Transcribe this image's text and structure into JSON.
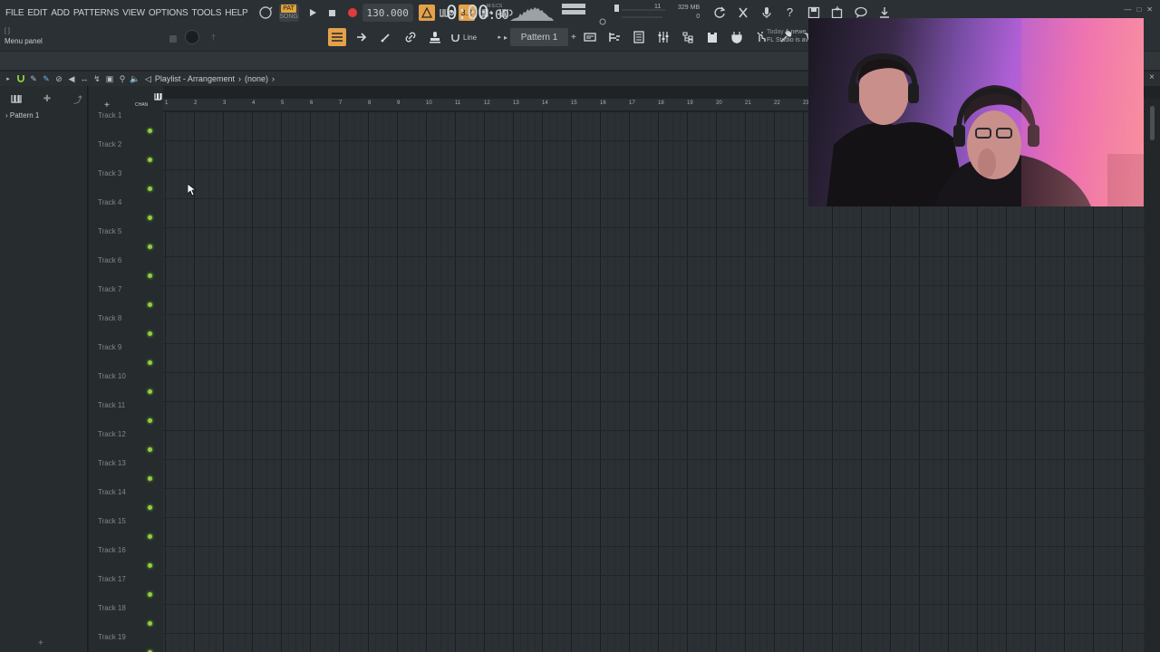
{
  "menu": [
    "FILE",
    "EDIT",
    "ADD",
    "PATTERNS",
    "VIEW",
    "OPTIONS",
    "TOOLS",
    "HELP"
  ],
  "transport": {
    "pat_label": "PAT",
    "song_label": "SONG",
    "tempo": "130.000"
  },
  "time": {
    "value": "0:00",
    "sub": ":00",
    "unit": "M:S:CS"
  },
  "stats": {
    "cpu": "11",
    "memory": "329 MB",
    "voices": "0"
  },
  "hint": {
    "bracket": "[  ]",
    "label": "Menu panel"
  },
  "snap": {
    "label": "Line"
  },
  "pattern_select": {
    "label": "Pattern 1"
  },
  "news": {
    "line1_date": "Today",
    "line1_text": "A newe",
    "line2": "FL Studio is av"
  },
  "playlist": {
    "title": "Playlist - Arrangement",
    "sep": "›",
    "context": "(none)",
    "close": "×",
    "picker_item": "› Pattern 1",
    "picker_add": "+",
    "chan_label": "CHAN"
  },
  "tracks": [
    "Track 1",
    "Track 2",
    "Track 3",
    "Track 4",
    "Track 5",
    "Track 6",
    "Track 7",
    "Track 8",
    "Track 9",
    "Track 10",
    "Track 11",
    "Track 12",
    "Track 13",
    "Track 14",
    "Track 15",
    "Track 16",
    "Track 17",
    "Track 18",
    "Track 19"
  ],
  "ruler_bars": [
    "1",
    "2",
    "3",
    "4",
    "5",
    "6",
    "7",
    "8",
    "9",
    "10",
    "11",
    "12",
    "13",
    "14",
    "15",
    "16",
    "17",
    "18",
    "19",
    "20",
    "21",
    "22",
    "23"
  ],
  "colors": {
    "accent": "#e3a24a",
    "record": "#e23b3b",
    "track_led": "#8fd13d"
  }
}
